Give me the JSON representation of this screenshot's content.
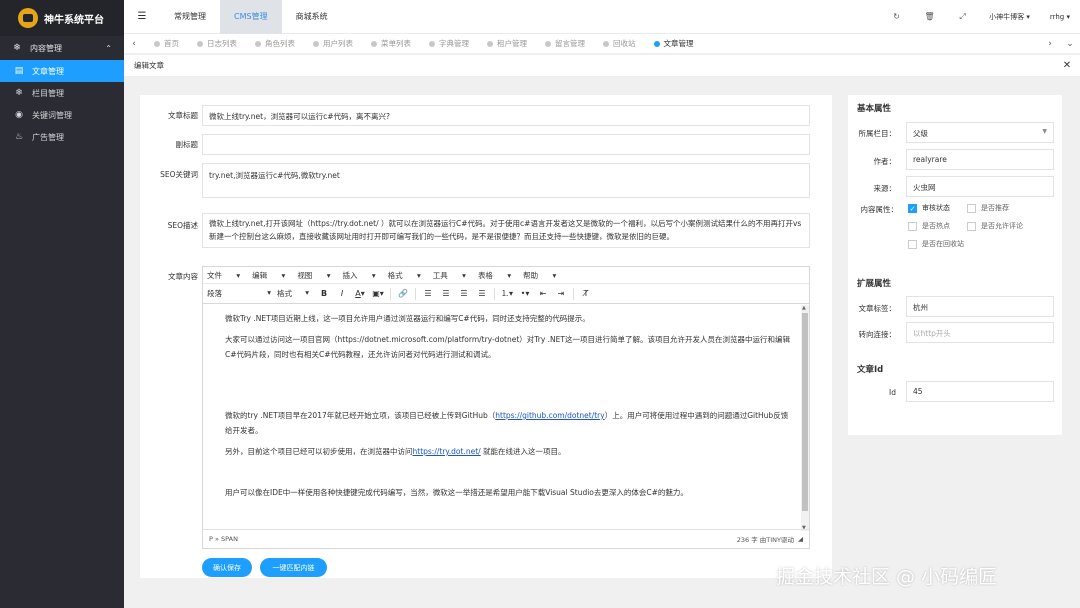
{
  "app": {
    "title": "神牛系统平台"
  },
  "sidebar": {
    "group": "内容管理",
    "items": [
      {
        "label": "文章管理",
        "icon": "book-icon",
        "active": true
      },
      {
        "label": "栏目管理",
        "icon": "snowflake-icon",
        "active": false
      },
      {
        "label": "关键词管理",
        "icon": "target-icon",
        "active": false
      },
      {
        "label": "广告管理",
        "icon": "flame-icon",
        "active": false
      }
    ]
  },
  "topnav": {
    "items": [
      {
        "label": "常规管理"
      },
      {
        "label": "CMS管理",
        "active": true
      },
      {
        "label": "商城系统"
      }
    ],
    "user1": "小神牛博客",
    "user2": "rrhg"
  },
  "tabs": [
    {
      "label": "首页"
    },
    {
      "label": "日志列表"
    },
    {
      "label": "角色列表"
    },
    {
      "label": "用户列表"
    },
    {
      "label": "菜单列表"
    },
    {
      "label": "字典管理"
    },
    {
      "label": "租户管理"
    },
    {
      "label": "留言管理"
    },
    {
      "label": "回收站"
    },
    {
      "label": "文章管理",
      "active": true
    }
  ],
  "subhead": {
    "title": "编辑文章"
  },
  "form": {
    "title_label": "文章标题",
    "title_value": "微软上线try.net，浏览器可以运行c#代码，离不离兴?",
    "subtitle_label": "副标题",
    "subtitle_value": "",
    "seo_kw_label": "SEO关键词",
    "seo_kw_value": "try.net,浏览器运行c#代码,微软try.net",
    "seo_desc_label": "SEO描述",
    "seo_desc_value": "微软上线try.net,打开该网址（https://try.dot.net/ ）就可以在浏览器运行C#代码。对于使用c#语言开发者这又是微软的一个福利，以后写个小案例测试结果什么的不用再打开vs新建一个控制台这么麻烦，直接收藏该网址用时打开即可编写我们的一些代码，是不是很便捷？而且还支持一些快捷键，微软是依旧的巨硬。",
    "content_label": "文章内容"
  },
  "editor": {
    "menus": [
      "文件",
      "编辑",
      "视图",
      "插入",
      "格式",
      "工具",
      "表格",
      "帮助"
    ],
    "format_select": "段落",
    "style_select": "格式",
    "p1": "微软Try .NET项目近期上线，这一项目允许用户通过浏览器运行和编写C#代码，同时还支持完整的代码提示。",
    "p2": "大家可以通过访问这一项目官网（https://dotnet.microsoft.com/platform/try-dotnet）对Try .NET这一项目进行简单了解。该项目允许开发人员在浏览器中运行和编辑C#代码片段，同时也有相关C#代码教程，还允许访问者对代码进行测试和调试。",
    "p3a": "微软的try .NET项目早在2017年就已经开始立项，该项目已经被上传到GitHub（",
    "p3link": "https://github.com/dotnet/try",
    "p3b": "）上。用户可将使用过程中遇到的问题通过GitHub反馈给开发者。",
    "p4a": "另外，目前这个项目已经可以初步使用，在浏览器中访问",
    "p4link": "https://try.dot.net/",
    "p4b": " 就能在线进入这一项目。",
    "p5": "用户可以像在IDE中一样使用各种快捷键完成代码编写，当然，微软这一举措还是希望用户能下载Visual Studio去更深入的体会C#的魅力。",
    "path": "P » SPAN",
    "wordcount": "236 字 由TINY驱动"
  },
  "buttons": {
    "save": "确认保存",
    "match": "一键匹配内链"
  },
  "right": {
    "basic_title": "基本属性",
    "col_label": "所属栏目：",
    "col_value": "父级",
    "author_label": "作者：",
    "author_value": "realyrare",
    "source_label": "来源：",
    "source_value": "火虫网",
    "attr_label": "内容属性：",
    "checks": [
      {
        "label": "审核状态",
        "on": true
      },
      {
        "label": "是否推荐",
        "on": false
      },
      {
        "label": "是否热点",
        "on": false
      },
      {
        "label": "是否允许评论",
        "on": false
      },
      {
        "label": "是否在回收站",
        "on": false
      }
    ],
    "ext_title": "扩展属性",
    "tag_label": "文章标签：",
    "tag_value": "杭州",
    "redirect_label": "转向连接：",
    "redirect_placeholder": "以http开头",
    "id_title": "文章Id",
    "id_label": "Id",
    "id_value": "45"
  },
  "watermark": "掘金技术社区 @ 小码编匠",
  "colors": {
    "accent": "#1e9fff",
    "sidebar": "#2b2c33"
  }
}
